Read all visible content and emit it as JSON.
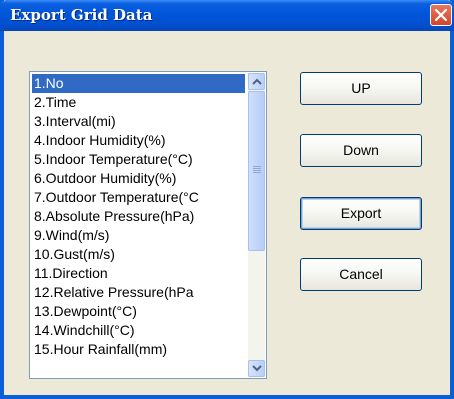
{
  "window": {
    "title": "Export Grid Data"
  },
  "list": {
    "selected_index": 0,
    "items": [
      "1.No",
      "2.Time",
      "3.Interval(mi)",
      "4.Indoor Humidity(%)",
      "5.Indoor Temperature(°C)",
      "6.Outdoor Humidity(%)",
      "7.Outdoor Temperature(°C",
      "8.Absolute Pressure(hPa)",
      "9.Wind(m/s)",
      "10.Gust(m/s)",
      "11.Direction",
      "12.Relative Pressure(hPa",
      "13.Dewpoint(°C)",
      "14.Windchill(°C)",
      "15.Hour Rainfall(mm)"
    ]
  },
  "buttons": {
    "up": "UP",
    "down": "Down",
    "export": "Export",
    "cancel": "Cancel"
  },
  "colors": {
    "titlebar": "#0055d9",
    "selection": "#316ac5",
    "dialog_bg": "#ece9d8",
    "close_button": "#d2452b"
  }
}
